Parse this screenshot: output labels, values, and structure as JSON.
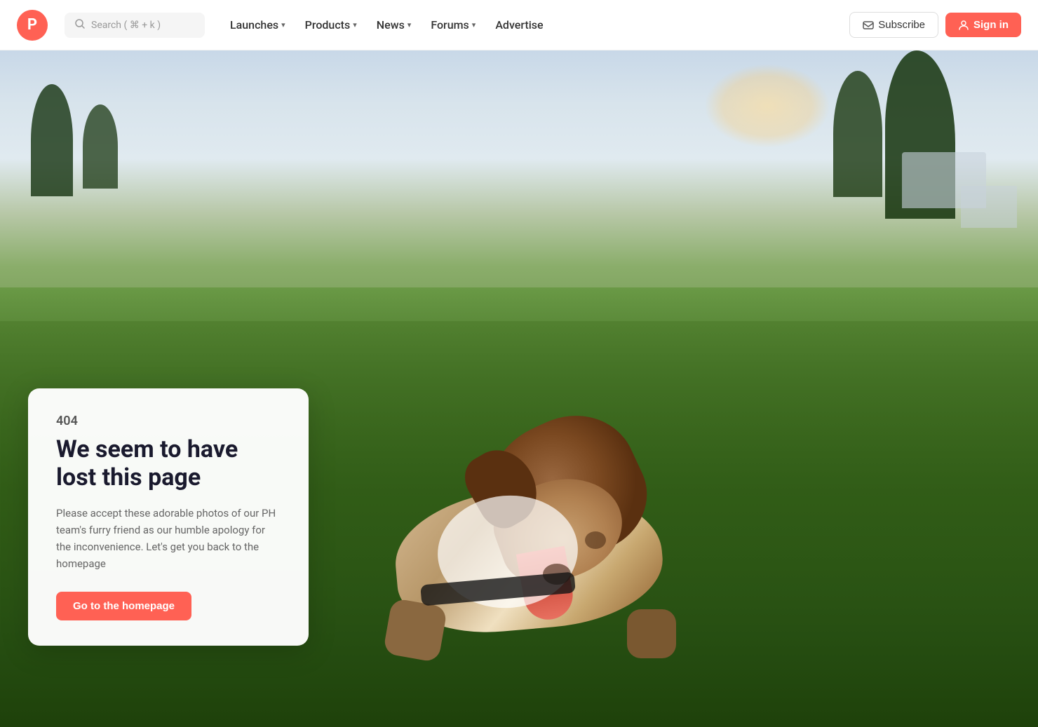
{
  "brand": {
    "logo_letter": "P",
    "logo_bg": "#ff6154"
  },
  "navbar": {
    "search_placeholder": "Search ( ⌘ + k )",
    "links": [
      {
        "label": "Launches",
        "has_dropdown": true
      },
      {
        "label": "Products",
        "has_dropdown": true
      },
      {
        "label": "News",
        "has_dropdown": true
      },
      {
        "label": "Forums",
        "has_dropdown": true
      },
      {
        "label": "Advertise",
        "has_dropdown": false
      }
    ],
    "subscribe_label": "Subscribe",
    "signin_label": "Sign in"
  },
  "error_page": {
    "code": "404",
    "title_line1": "We seem to have",
    "title_line2": "lost this page",
    "description": "Please accept these adorable photos of our PH team's furry friend as our humble apology for the inconvenience. Let's get you back to the homepage",
    "cta_label": "Go to the homepage"
  }
}
